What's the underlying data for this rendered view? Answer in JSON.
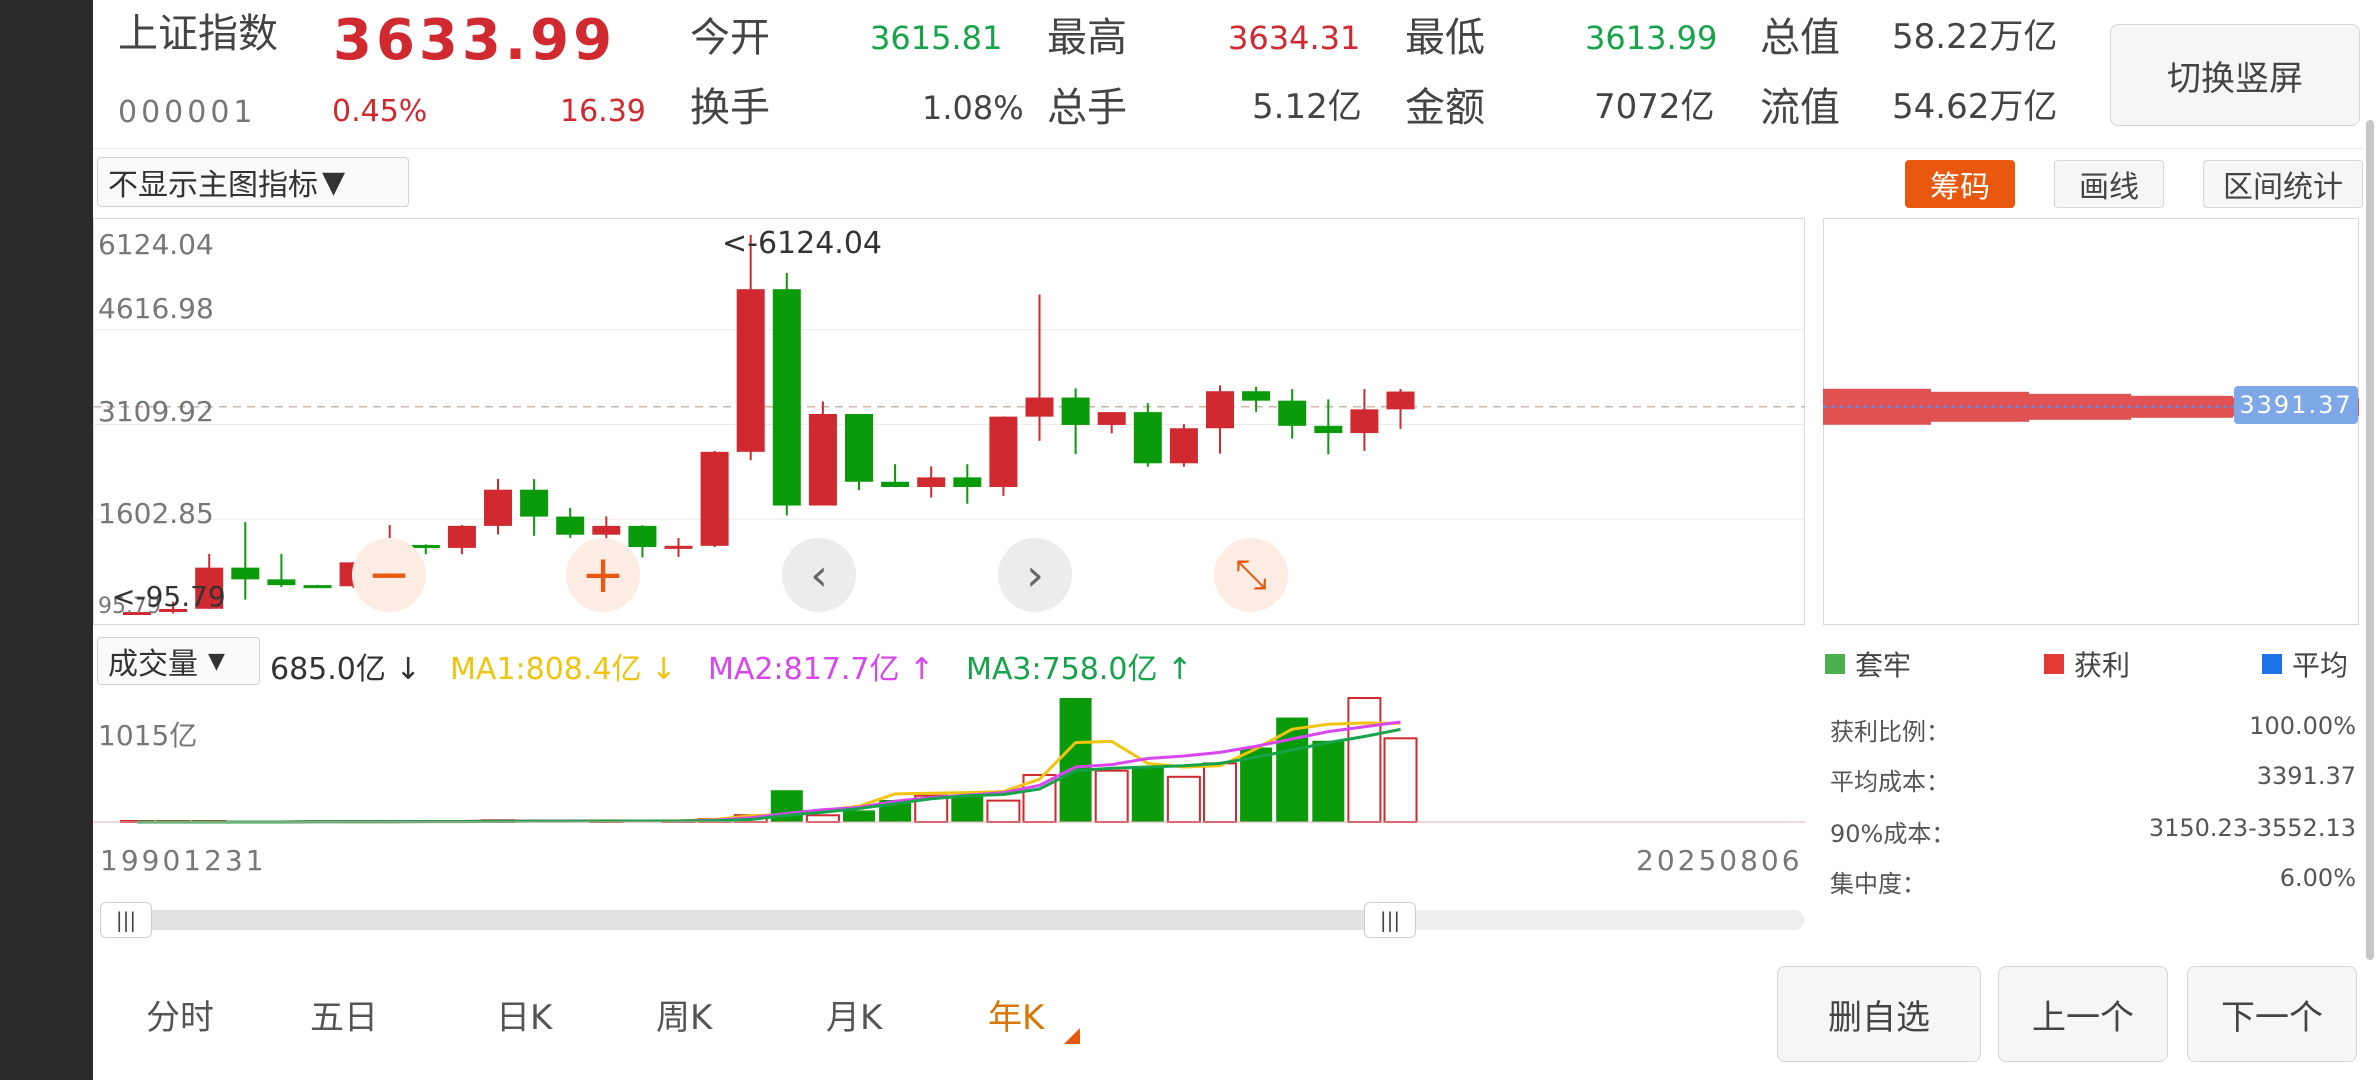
{
  "header": {
    "index_name": "上证指数",
    "price": "3633.99",
    "code": "000001",
    "change_pct": "0.45%",
    "change": "16.39",
    "fields": [
      {
        "label": "今开",
        "value": "3615.81",
        "color": "green"
      },
      {
        "label": "最高",
        "value": "3634.31",
        "color": "red"
      },
      {
        "label": "最低",
        "value": "3613.99",
        "color": "green"
      },
      {
        "label": "总值",
        "value": "58.22万亿",
        "color": "dark"
      },
      {
        "label": "换手",
        "value": "1.08%",
        "color": "dark"
      },
      {
        "label": "总手",
        "value": "5.12亿",
        "color": "dark"
      },
      {
        "label": "金额",
        "value": "7072亿",
        "color": "dark"
      },
      {
        "label": "流值",
        "value": "54.62万亿",
        "color": "dark"
      }
    ],
    "switch_button": "切换竖屏"
  },
  "toolbar": {
    "main_indicator_select": "不显示主图指标",
    "chips_button": "筹码",
    "draw_button": "画线",
    "range_stats_button": "区间统计"
  },
  "kline": {
    "y_ticks": [
      "6124.04",
      "4616.98",
      "3109.92",
      "1602.85",
      "95.79"
    ],
    "max_annotation": "<-6124.04",
    "min_annotation": "<-95.79"
  },
  "volume": {
    "select": "成交量",
    "current": "685.0亿",
    "ma1": "MA1:808.4亿",
    "ma2": "MA2:817.7亿",
    "ma3": "MA3:758.0亿",
    "y_tick": "1015亿",
    "start_date": "19901231",
    "end_date": "20250806"
  },
  "chip": {
    "avg_cost_tag": "3391.37",
    "legend": [
      {
        "label": "套牢",
        "color": "#4caf50"
      },
      {
        "label": "获利",
        "color": "#e53935"
      },
      {
        "label": "平均",
        "color": "#1e73e8"
      }
    ],
    "stats": [
      {
        "label": "获利比例：",
        "value": "100.00%"
      },
      {
        "label": "平均成本：",
        "value": "3391.37"
      },
      {
        "label": "90%成本：",
        "value": "3150.23-3552.13"
      },
      {
        "label": "集中度：",
        "value": "6.00%"
      }
    ]
  },
  "periods": [
    "分时",
    "五日",
    "日K",
    "周K",
    "月K",
    "年K"
  ],
  "active_period": "年K",
  "footer_buttons": [
    "删自选",
    "上一个",
    "下一个"
  ],
  "colors": {
    "up": "#d0292f",
    "down": "#0a9a0a",
    "accent": "#e8580f",
    "ma1": "#f1c40f",
    "ma2": "#d946ef",
    "ma3": "#16a34a"
  },
  "chart_data": {
    "type": "candlestick",
    "ylim": [
      95.79,
      6124.04
    ],
    "candles": [
      {
        "o": 99,
        "h": 128,
        "l": 95.79,
        "c": 127
      },
      {
        "o": 128,
        "h": 292,
        "l": 105,
        "c": 176
      },
      {
        "o": 179,
        "h": 1052,
        "l": 177,
        "c": 833
      },
      {
        "o": 833,
        "h": 1558,
        "l": 325,
        "c": 647
      },
      {
        "o": 647,
        "h": 1053,
        "l": 524,
        "c": 555
      },
      {
        "o": 555,
        "h": 560,
        "l": 512,
        "c": 537
      },
      {
        "o": 537,
        "h": 918,
        "l": 512,
        "c": 917
      },
      {
        "o": 917,
        "h": 1510,
        "l": 855,
        "c": 1194
      },
      {
        "o": 1194,
        "h": 1204,
        "l": 1047,
        "c": 1147
      },
      {
        "o": 1147,
        "h": 1512,
        "l": 1047,
        "c": 1497
      },
      {
        "o": 1497,
        "h": 2245,
        "l": 1361,
        "c": 2073
      },
      {
        "o": 2073,
        "h": 2242,
        "l": 1339,
        "c": 1645
      },
      {
        "o": 1645,
        "h": 1783,
        "l": 1307,
        "c": 1357
      },
      {
        "o": 1357,
        "h": 1649,
        "l": 1259,
        "c": 1497
      },
      {
        "o": 1497,
        "h": 1508,
        "l": 998,
        "c": 1161
      },
      {
        "o": 1161,
        "h": 1304,
        "l": 1004,
        "c": 1180
      },
      {
        "o": 1180,
        "h": 2688,
        "l": 1161,
        "c": 2675
      },
      {
        "o": 2675,
        "h": 6124.04,
        "l": 2541,
        "c": 5262
      },
      {
        "o": 5262,
        "h": 5522,
        "l": 1664,
        "c": 1821
      },
      {
        "o": 1821,
        "h": 3478,
        "l": 1844,
        "c": 3277
      },
      {
        "o": 3277,
        "h": 3067,
        "l": 2067,
        "c": 2199
      },
      {
        "o": 2199,
        "h": 2478,
        "l": 2132,
        "c": 2116
      },
      {
        "o": 2116,
        "h": 2444,
        "l": 1949,
        "c": 2269
      },
      {
        "o": 2269,
        "h": 2478,
        "l": 1849,
        "c": 2116
      },
      {
        "o": 2116,
        "h": 3239,
        "l": 1974,
        "c": 3235
      },
      {
        "o": 3235,
        "h": 5178,
        "l": 2850,
        "c": 3539
      },
      {
        "o": 3539,
        "h": 3684,
        "l": 2638,
        "c": 3103
      },
      {
        "o": 3103,
        "h": 3288,
        "l": 2969,
        "c": 3307
      },
      {
        "o": 3307,
        "h": 3450,
        "l": 2440,
        "c": 2493
      },
      {
        "o": 2493,
        "h": 3115,
        "l": 2440,
        "c": 3050
      },
      {
        "o": 3050,
        "h": 3731,
        "l": 2646,
        "c": 3639
      },
      {
        "o": 3639,
        "h": 3708,
        "l": 3312,
        "c": 3489
      },
      {
        "o": 3489,
        "h": 3674,
        "l": 2885,
        "c": 3089
      },
      {
        "o": 3089,
        "h": 3509,
        "l": 2635,
        "c": 2974
      },
      {
        "o": 2974,
        "h": 3674,
        "l": 2690,
        "c": 3351
      },
      {
        "o": 3351,
        "h": 3674,
        "l": 3040,
        "c": 3633.99
      }
    ],
    "volume_yi": [
      0,
      0,
      0.5,
      0.5,
      0,
      0,
      1,
      1,
      6,
      5,
      15,
      8,
      6,
      8,
      8,
      8,
      25,
      56,
      260,
      55,
      95,
      180,
      215,
      215,
      175,
      385,
      1015,
      420,
      455,
      370,
      480,
      610,
      855,
      665,
      1015,
      685
    ],
    "ma1_yi": [
      0,
      0,
      0,
      0,
      0,
      5,
      2,
      2,
      5,
      5,
      10,
      8,
      8,
      10,
      8,
      10,
      20,
      52,
      60,
      90,
      130,
      230,
      235,
      240,
      250,
      350,
      650,
      660,
      480,
      450,
      460,
      600,
      760,
      800,
      810,
      808.4
    ],
    "ma2_yi": [
      0,
      0,
      0,
      0,
      0,
      3,
      3,
      3,
      4,
      4,
      8,
      8,
      8,
      8,
      8,
      8,
      15,
      35,
      70,
      100,
      120,
      170,
      200,
      220,
      240,
      300,
      450,
      470,
      520,
      540,
      570,
      620,
      680,
      740,
      780,
      817.7
    ],
    "ma3_yi": [
      0,
      0,
      0,
      0,
      0,
      2,
      2,
      2,
      3,
      3,
      5,
      6,
      6,
      7,
      7,
      7,
      10,
      20,
      55,
      80,
      110,
      150,
      190,
      215,
      225,
      270,
      420,
      440,
      450,
      460,
      480,
      530,
      590,
      650,
      700,
      758.0
    ],
    "chip_avg_cost": 3391.37
  }
}
